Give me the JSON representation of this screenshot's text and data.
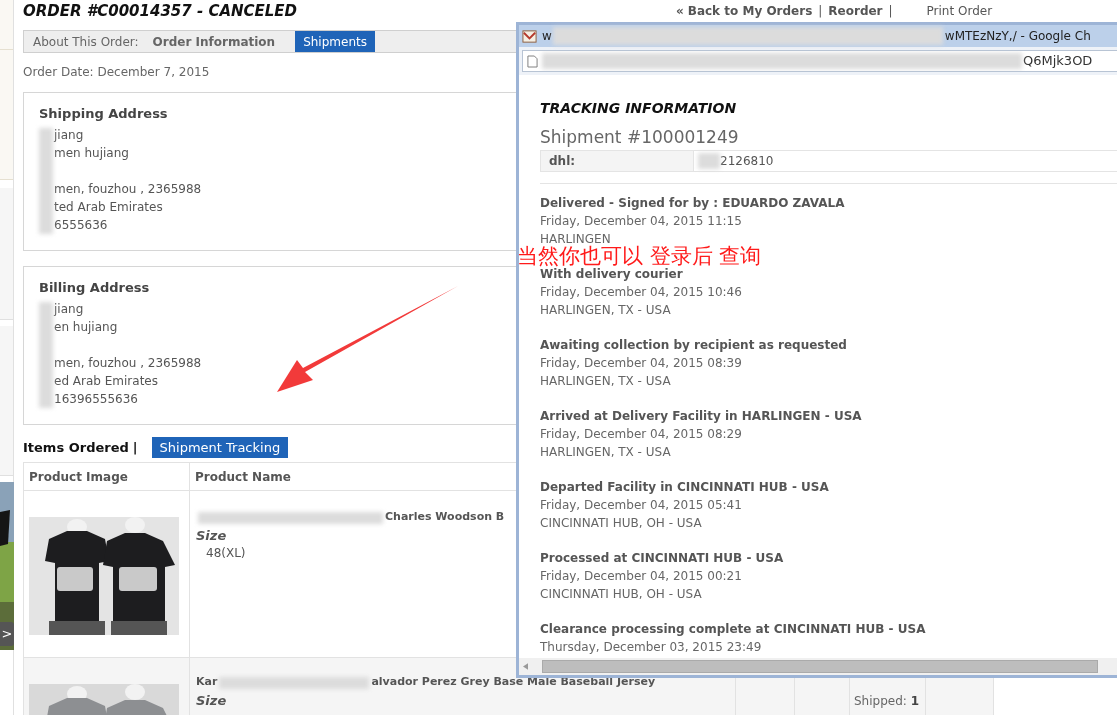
{
  "sidebar": {
    "next_glyph": ">"
  },
  "header": {
    "title": "ORDER #C00014357 - CANCELED",
    "back_glyph": "«",
    "links": [
      {
        "text": "Back to My Orders",
        "kind": "bold"
      },
      {
        "text": "|",
        "kind": "separator"
      },
      {
        "text": "Reorder",
        "kind": "bold"
      },
      {
        "text": "|",
        "kind": "separator"
      },
      {
        "text": "Print Order",
        "kind": "plain"
      }
    ]
  },
  "order_tabs": {
    "label": "About This Order:",
    "items": [
      {
        "text": "Order Information",
        "selected": false
      },
      {
        "text": "Shipments",
        "selected": true
      }
    ]
  },
  "order_date": "Order Date: December 7, 2015",
  "addresses": [
    {
      "title": "Shipping Address",
      "line_groups": [
        [
          "jiang",
          "men hujiang"
        ],
        [
          "men, fouzhou , 2365988",
          "ted Arab Emirates",
          "6555636"
        ]
      ]
    },
    {
      "title": "Billing Address",
      "line_groups": [
        [
          "jiang",
          "en hujiang"
        ],
        [
          "men, fouzhou , 2365988",
          "ed Arab Emirates",
          "16396555636"
        ]
      ]
    }
  ],
  "items_tabs": {
    "items": [
      {
        "text": "Items Ordered",
        "selected": false
      },
      {
        "text": "|",
        "selected": false
      },
      {
        "text": "Shipment Tracking",
        "selected": true
      }
    ]
  },
  "table": {
    "columns": [
      "Product Image",
      "Product Name"
    ],
    "rows": [
      {
        "name_start": "",
        "name_end": "Charles Woodson B",
        "size_label": "Size",
        "size": "48(XL)"
      },
      {
        "name_start": "Kar",
        "name_end": "alvador Perez Grey Base Male Baseball Jersey",
        "size_label": "Size",
        "shipped_label": "Shipped:",
        "shipped": "1"
      }
    ]
  },
  "popup": {
    "title_start": "w",
    "title_end": "wMTEzNzY,/ - Google Ch",
    "address_end": "Q6Mjk3OD",
    "heading": "TRACKING INFORMATION",
    "shipment": "Shipment #100001249",
    "carrier": "dhl:",
    "tracking_number": "2126810",
    "events": [
      {
        "status": "Delivered - Signed for by : EDUARDO ZAVALA",
        "date": "Friday, December 04, 2015 11:15",
        "location": "HARLINGEN"
      },
      {
        "status": "With delivery courier",
        "date": "Friday, December 04, 2015 10:46",
        "location": "HARLINGEN, TX - USA"
      },
      {
        "status": "Awaiting collection by recipient as requested",
        "date": "Friday, December 04, 2015 08:39",
        "location": "HARLINGEN, TX - USA"
      },
      {
        "status": "Arrived at Delivery Facility in HARLINGEN - USA",
        "date": "Friday, December 04, 2015 08:29",
        "location": "HARLINGEN, TX - USA"
      },
      {
        "status": "Departed Facility in CINCINNATI HUB - USA",
        "date": "Friday, December 04, 2015 05:41",
        "location": "CINCINNATI HUB, OH - USA"
      },
      {
        "status": "Processed at CINCINNATI HUB - USA",
        "date": "Friday, December 04, 2015 00:21",
        "location": "CINCINNATI HUB, OH - USA"
      },
      {
        "status": "Clearance processing complete at CINCINNATI HUB - USA",
        "date": "Thursday, December 03, 2015 23:49"
      }
    ]
  },
  "annotation": {
    "text": "当然你也可以 登录后 查询"
  }
}
